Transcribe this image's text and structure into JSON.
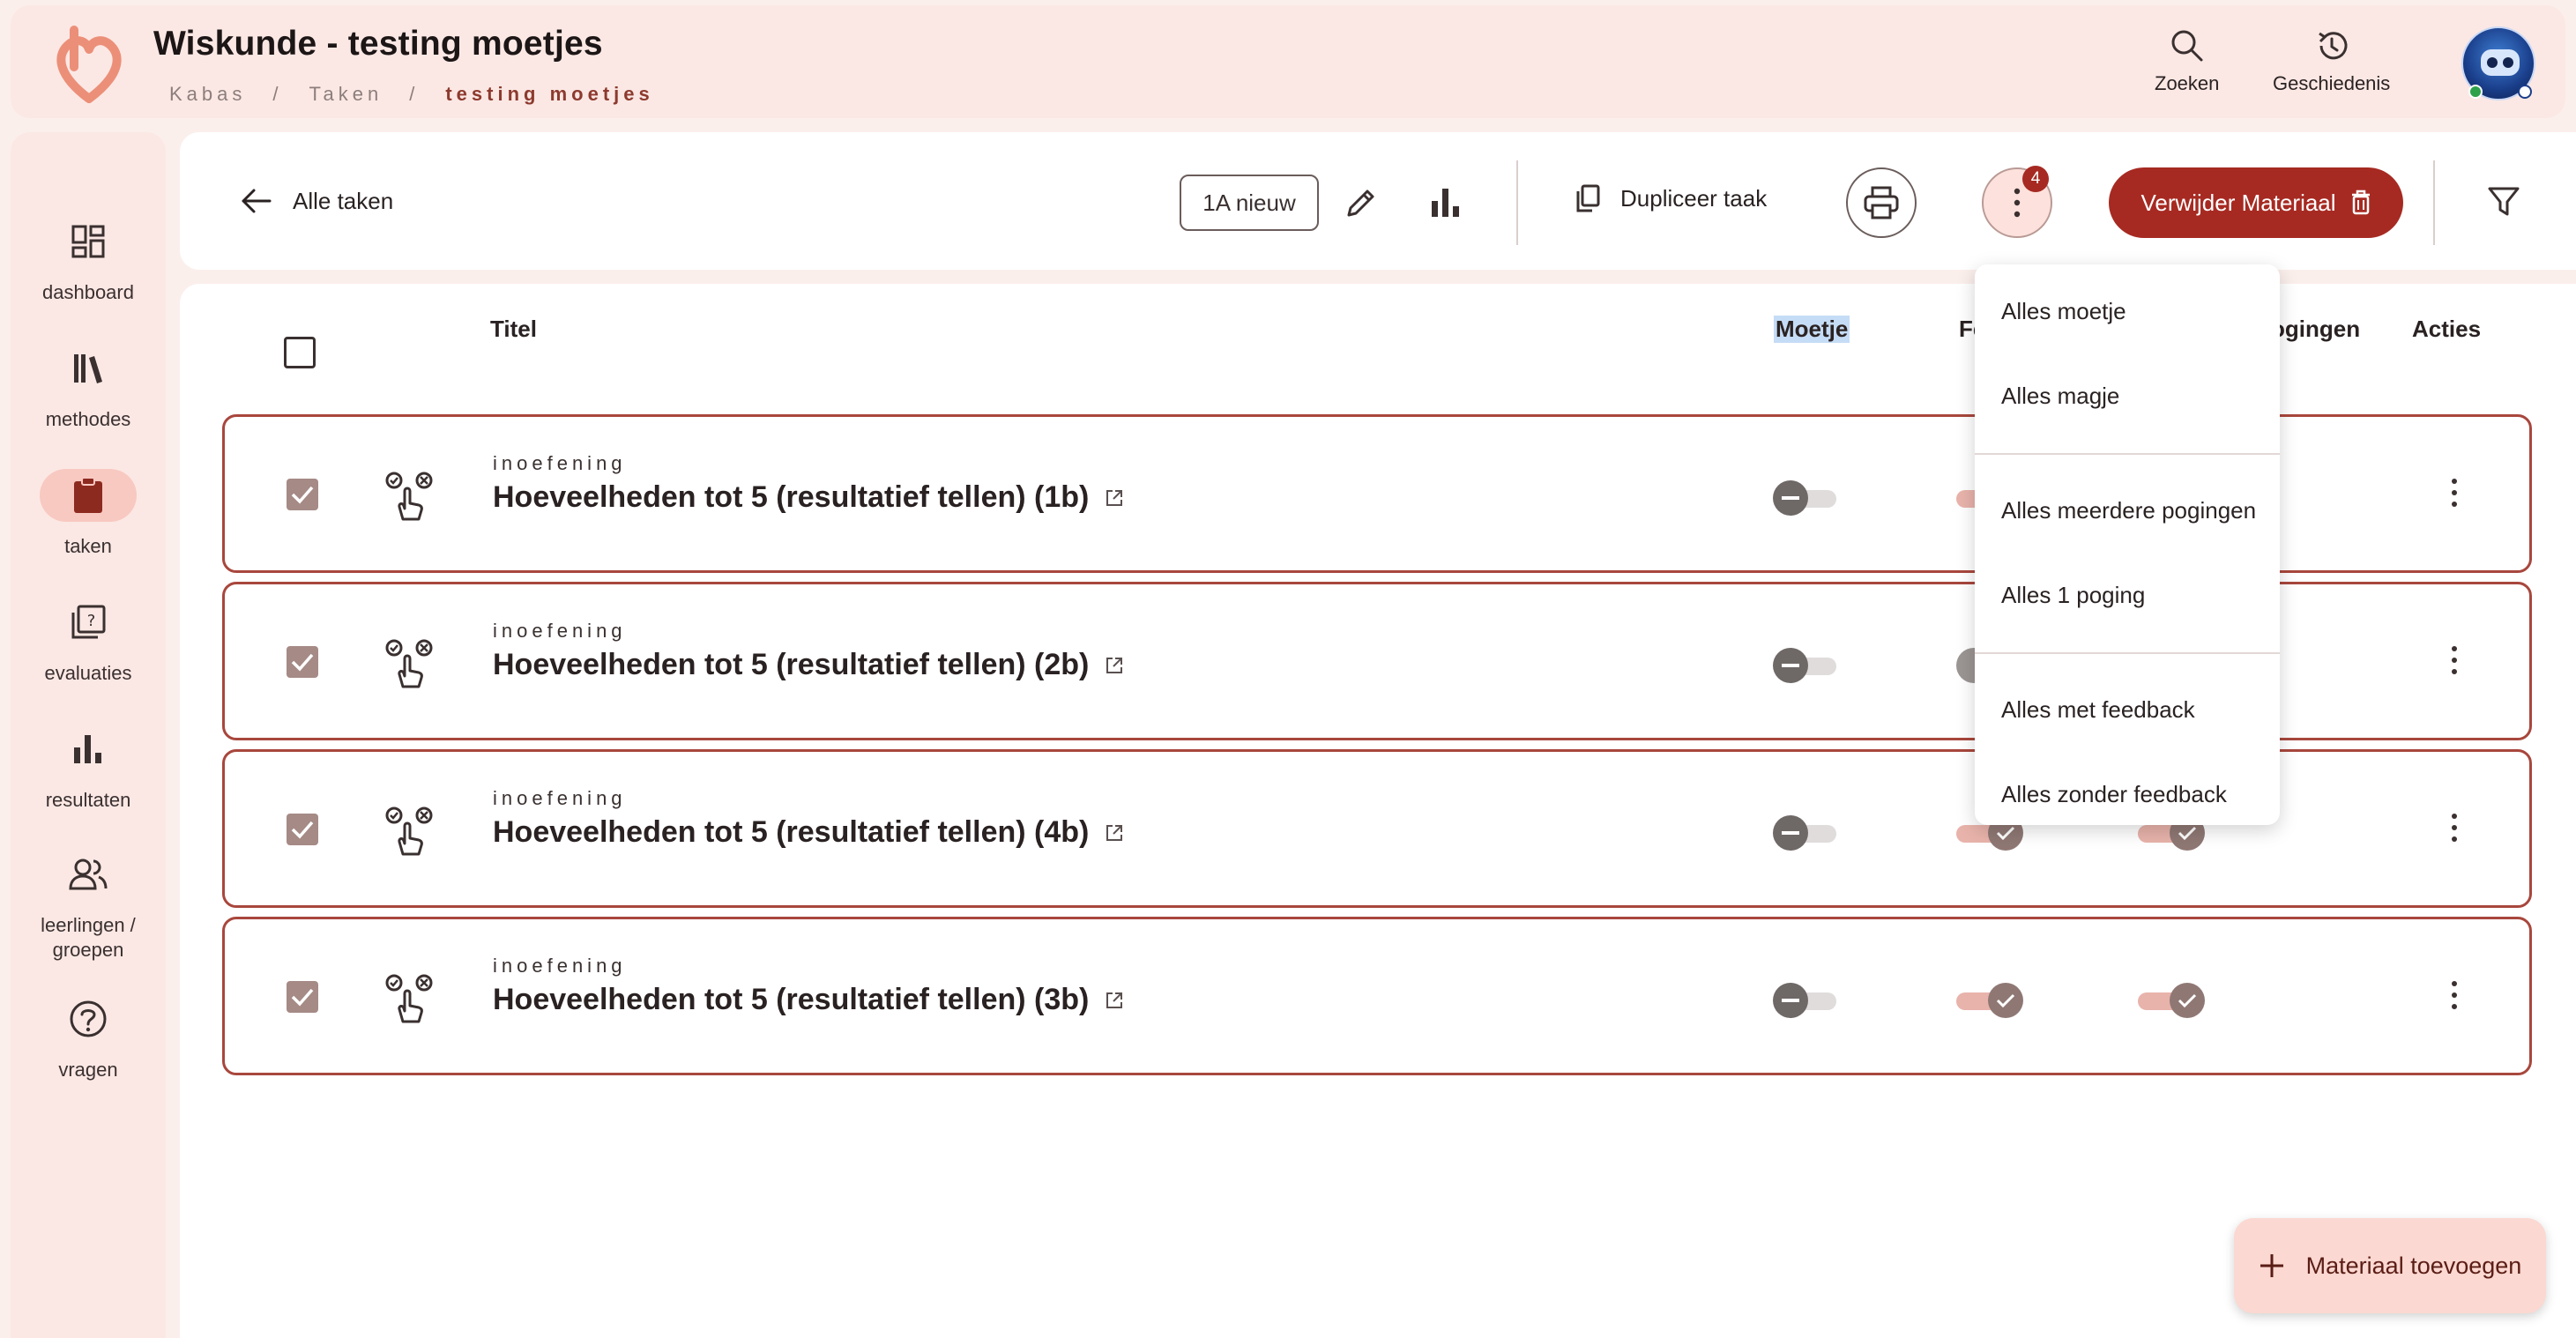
{
  "header": {
    "title": "Wiskunde - testing moetjes",
    "breadcrumb": [
      "Kabas",
      "/",
      "Taken",
      "/",
      "testing moetjes"
    ],
    "actions": [
      {
        "label": "Zoeken",
        "icon": "search-icon"
      },
      {
        "label": "Geschiedenis",
        "icon": "history-icon"
      }
    ]
  },
  "sidebar": {
    "items": [
      {
        "label": "dashboard",
        "icon": "dashboard-icon"
      },
      {
        "label": "methodes",
        "icon": "books-icon"
      },
      {
        "label": "taken",
        "icon": "clipboard-icon",
        "active": true
      },
      {
        "label": "evaluaties",
        "icon": "quiz-icon"
      },
      {
        "label": "resultaten",
        "icon": "bar-chart-icon"
      },
      {
        "label": "leerlingen /",
        "label2": "groepen",
        "icon": "people-icon"
      },
      {
        "label": "vragen",
        "icon": "question-icon"
      }
    ]
  },
  "toolbar": {
    "back_label": "Alle taken",
    "group_chip": "1A nieuw",
    "duplicate_label": "Dupliceer taak",
    "badge_count": "4",
    "delete_label": "Verwijder Materiaal"
  },
  "table": {
    "headers": {
      "title": "Titel",
      "moetje": "Moetje",
      "feedback": "Fe",
      "attempts": "ogingen",
      "actions": "Acties"
    },
    "rows": [
      {
        "kind": "inoefening",
        "title": "Hoeveelheden tot 5 (resultatief tellen) (1b)",
        "checked": true,
        "moetje": false
      },
      {
        "kind": "inoefening",
        "title": "Hoeveelheden tot 5 (resultatief tellen) (2b)",
        "checked": true,
        "moetje": false
      },
      {
        "kind": "inoefening",
        "title": "Hoeveelheden tot 5 (resultatief tellen) (4b)",
        "checked": true,
        "moetje": false,
        "feedback": true,
        "attempts": true
      },
      {
        "kind": "inoefening",
        "title": "Hoeveelheden tot 5 (resultatief tellen) (3b)",
        "checked": true,
        "moetje": false,
        "feedback": true,
        "attempts": true
      }
    ]
  },
  "menu": {
    "items": [
      "Alles moetje",
      "Alles magje",
      "Alles meerdere pogingen",
      "Alles 1 poging",
      "Alles met feedback",
      "Alles zonder feedback"
    ]
  },
  "fab": {
    "label": "Materiaal toevoegen"
  },
  "colors": {
    "accent": "#a62a22",
    "row_border": "#a8473d",
    "background": "#fbefec",
    "active_nav": "#f8c9c1"
  }
}
